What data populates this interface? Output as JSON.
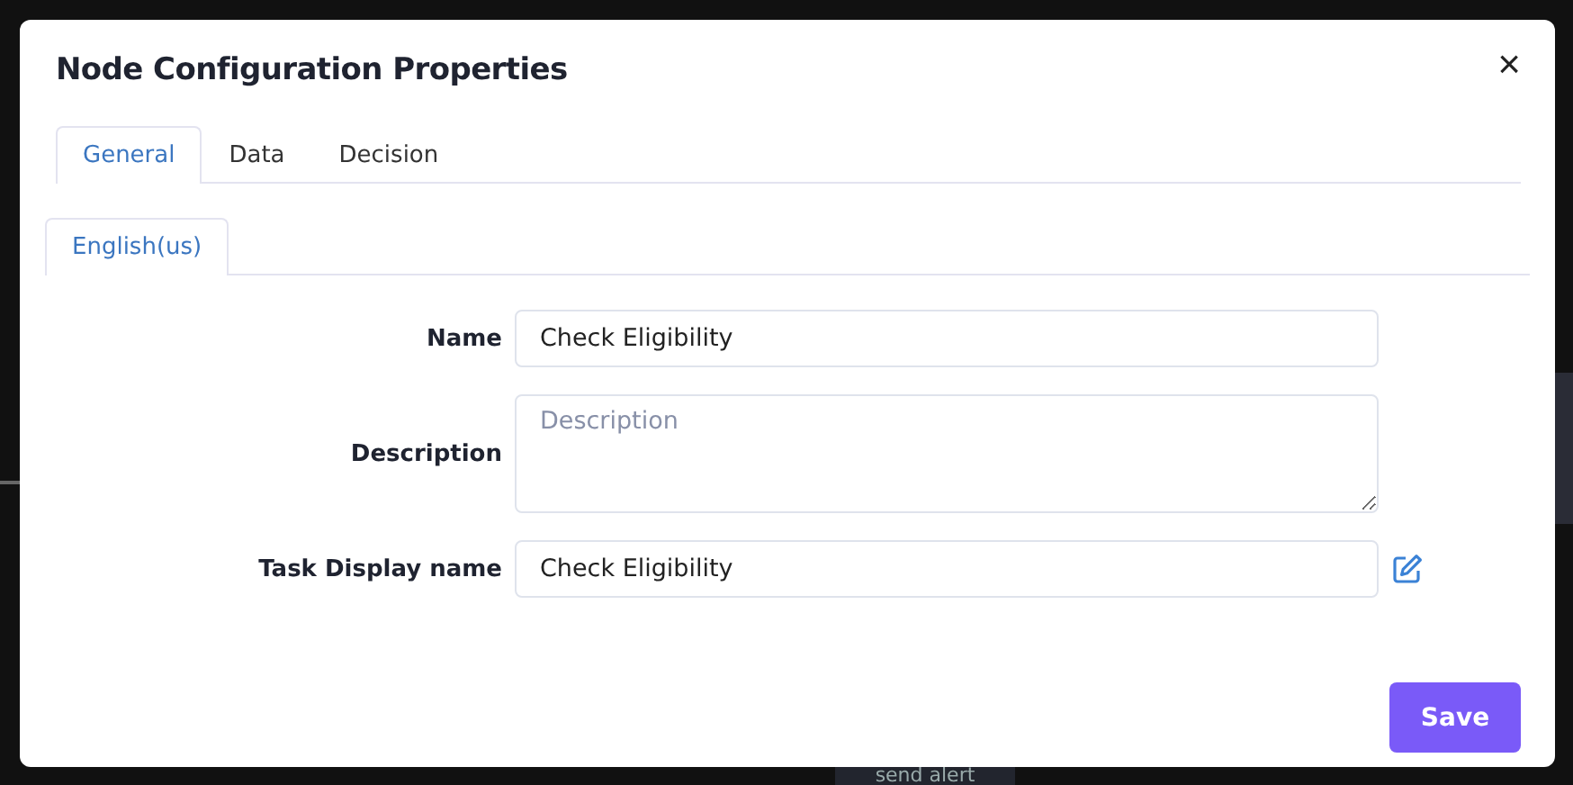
{
  "background": {
    "node_label": "send alert"
  },
  "dialog": {
    "title": "Node Configuration Properties",
    "close": "×",
    "tabs": [
      {
        "label": "General",
        "selected": true
      },
      {
        "label": "Data",
        "selected": false
      },
      {
        "label": "Decision",
        "selected": false
      }
    ],
    "language_tabs": [
      {
        "label": "English(us)",
        "selected": true
      }
    ],
    "fields": [
      {
        "kind": "input",
        "label": "Name",
        "value": "Check Eligibility"
      },
      {
        "kind": "textarea",
        "label": "Description",
        "placeholder": "Description"
      },
      {
        "kind": "input-edit",
        "label": "Task Display name",
        "value": "Check Eligibility"
      }
    ],
    "save_button": "Save"
  }
}
